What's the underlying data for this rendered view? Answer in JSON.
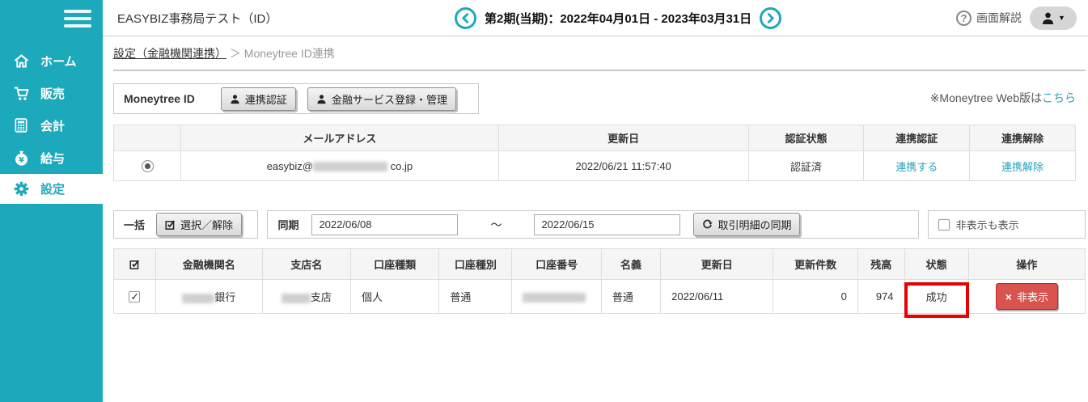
{
  "colors": {
    "accent": "#1da9bc",
    "link": "#2aa4bd",
    "danger": "#d9534f",
    "annotation": "#e60000",
    "sidebar_bg": "#1da9bc"
  },
  "sidebar": {
    "items": [
      {
        "label": "ホーム",
        "icon": "home"
      },
      {
        "label": "販売",
        "icon": "cart"
      },
      {
        "label": "会計",
        "icon": "calculator"
      },
      {
        "label": "給与",
        "icon": "money-bag"
      },
      {
        "label": "設定",
        "icon": "gear",
        "active": true
      }
    ]
  },
  "header": {
    "title": "EASYBIZ事務局テスト（ID）",
    "period": "第2期(当期)：2022年04月01日 - 2023年03月31日",
    "help_icon": "?",
    "help_label": "画面解説",
    "caret": "▼"
  },
  "breadcrumb": {
    "link": "設定（金融機関連携）",
    "separator": "＞",
    "current": "Moneytree ID連携"
  },
  "moneytree": {
    "label": "Moneytree ID",
    "auth_button": "連携認証",
    "manage_button": "金融サービス登録・管理",
    "web_note_prefix": "※Moneytree Web版は",
    "web_note_link": "こちら"
  },
  "accounts_table": {
    "headers": [
      "メールアドレス",
      "更新日",
      "認証状態",
      "連携認証",
      "連携解除"
    ],
    "row": {
      "selected": true,
      "email_prefix": "easybiz@",
      "email_redacted": true,
      "email_suffix": "co.jp",
      "updated": "2022/06/21 11:57:40",
      "auth_status": "認証済",
      "link_auth": "連携する",
      "link_release": "連携解除"
    }
  },
  "bulk": {
    "label": "一括",
    "select_button": "選択／解除",
    "sync_label": "同期",
    "date_from": "2022/06/08",
    "tilde": "～",
    "date_to": "2022/06/15",
    "sync_button": "取引明細の同期",
    "show_hidden_label": "非表示も表示",
    "show_hidden_checked": false
  },
  "bank_table": {
    "headers": [
      "金融機関名",
      "支店名",
      "口座種類",
      "口座種別",
      "口座番号",
      "名義",
      "更新日",
      "更新件数",
      "残高",
      "状態",
      "操作"
    ],
    "row": {
      "selected": true,
      "bank_suffix": "銀行",
      "branch_suffix": "支店",
      "account_category": "個人",
      "account_type": "普通",
      "account_number_redacted": true,
      "holder": "普通",
      "updated": "2022/06/11",
      "update_count": "0",
      "balance": "974",
      "status": "成功",
      "status_highlighted": true,
      "hide_icon": "×",
      "hide_button": "非表示"
    }
  }
}
